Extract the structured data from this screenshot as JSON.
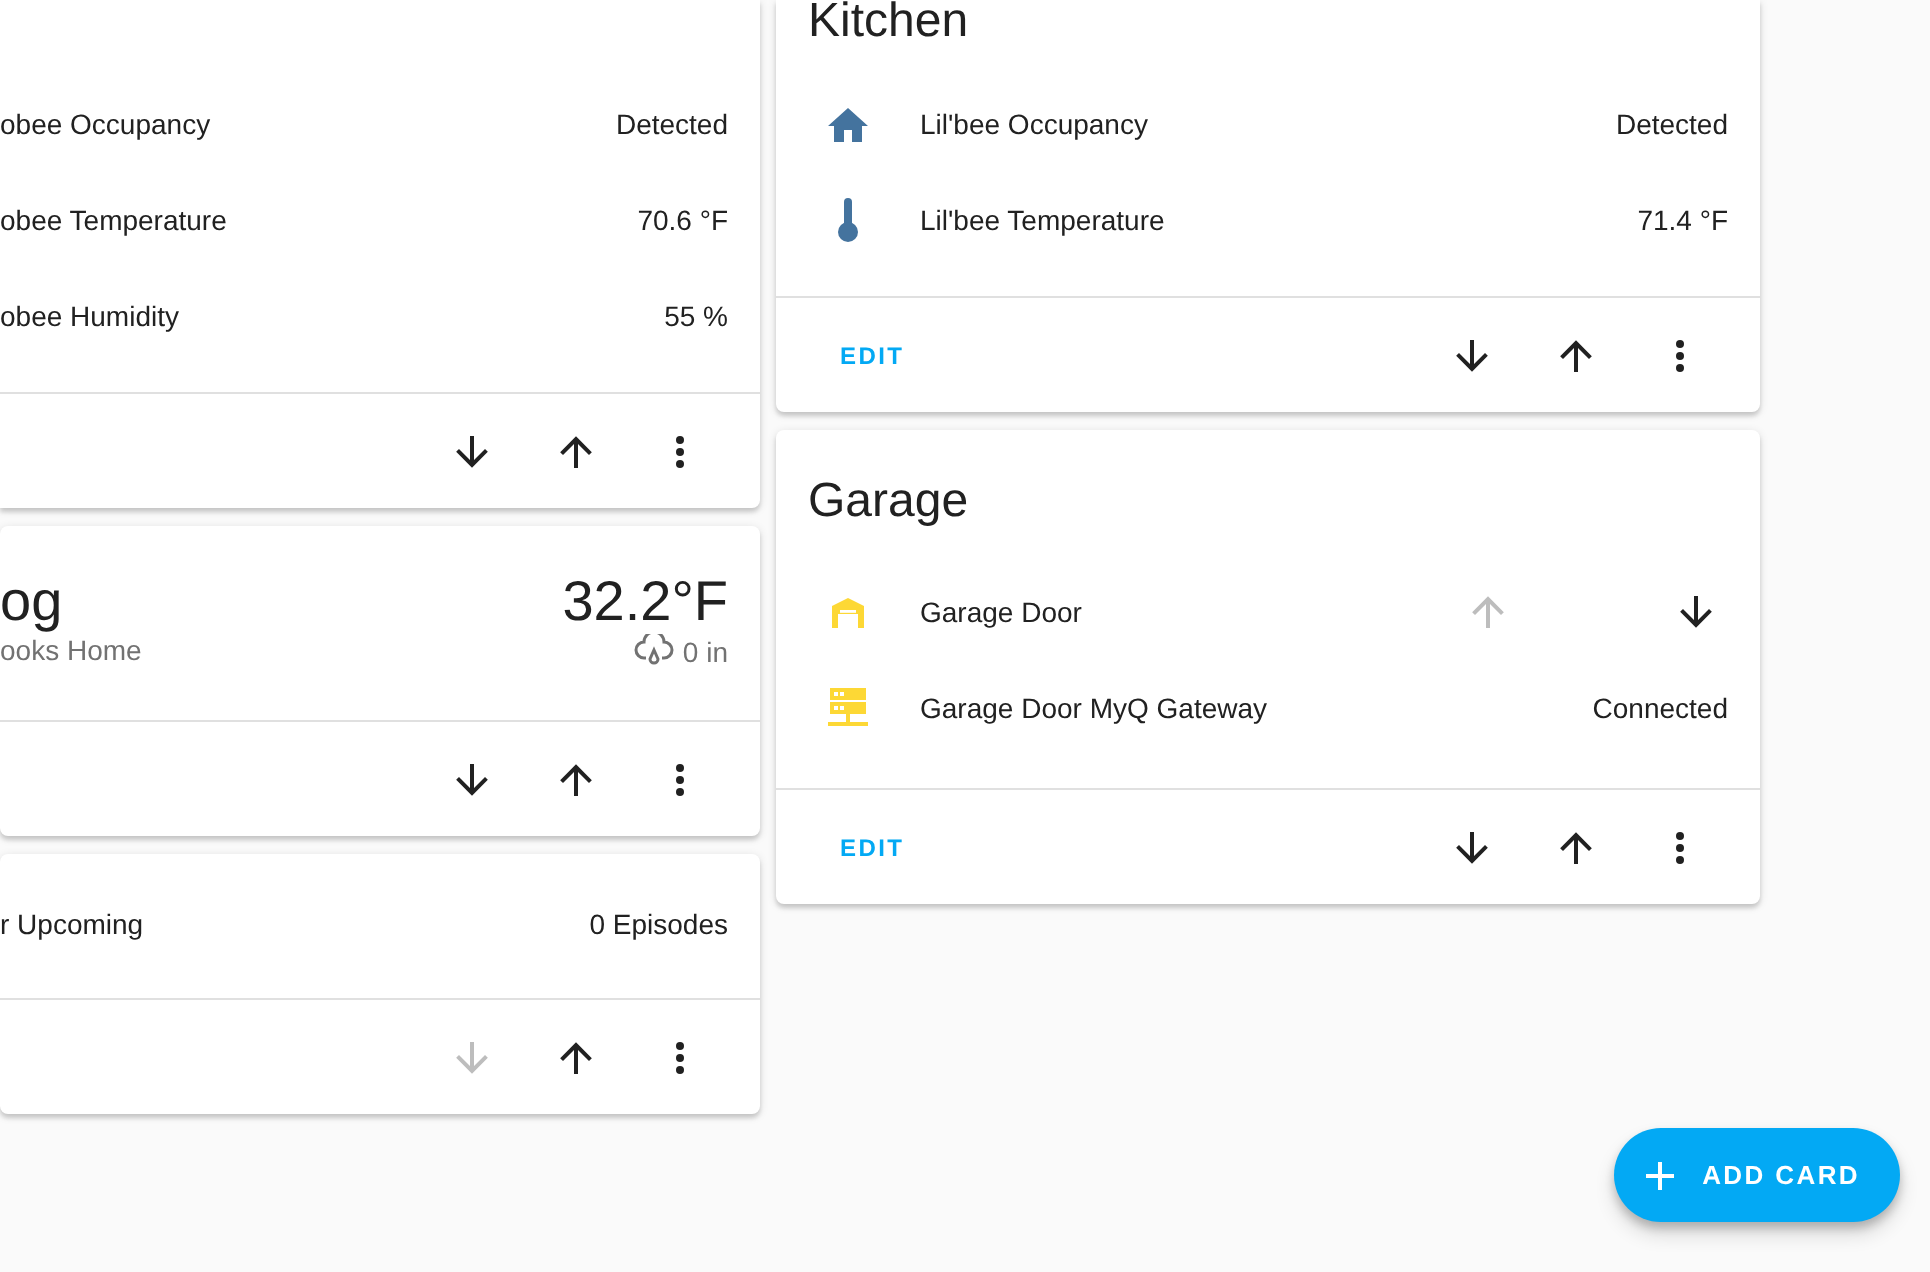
{
  "left_cards": [
    {
      "kind": "entities",
      "rows": [
        {
          "name": "obee Occupancy",
          "value": "Detected"
        },
        {
          "name": "obee Temperature",
          "value": "70.6 °F"
        },
        {
          "name": "obee Humidity",
          "value": "55 %"
        }
      ],
      "footer": {
        "move_down_disabled": false,
        "move_up_disabled": false
      }
    },
    {
      "kind": "weather",
      "name": "og",
      "location": "ooks Home",
      "temperature": "32.2°F",
      "precipitation": "0 in",
      "footer": {
        "move_down_disabled": false,
        "move_up_disabled": false
      }
    },
    {
      "kind": "entities",
      "rows": [
        {
          "name": "r Upcoming",
          "value": "0 Episodes"
        }
      ],
      "footer": {
        "move_down_disabled": true,
        "move_up_disabled": false
      }
    }
  ],
  "right_cards": [
    {
      "title": "Kitchen",
      "rows": [
        {
          "kind": "occupancy",
          "color": "#44739e",
          "name": "Lil'bee Occupancy",
          "value": "Detected"
        },
        {
          "kind": "temperature",
          "color": "#44739e",
          "name": "Lil'bee Temperature",
          "value": "71.4 °F"
        }
      ],
      "footer": {
        "edit_label": "EDIT",
        "move_down_disabled": false,
        "move_up_disabled": false
      }
    },
    {
      "title": "Garage",
      "rows": [
        {
          "kind": "cover",
          "color": "#fdd835",
          "name": "Garage Door",
          "open_disabled": true,
          "close_disabled": false
        },
        {
          "kind": "connectivity",
          "color": "#fdd835",
          "name": "Garage Door MyQ Gateway",
          "value": "Connected"
        }
      ],
      "footer": {
        "edit_label": "EDIT",
        "move_down_disabled": false,
        "move_up_disabled": false
      }
    }
  ],
  "fab": {
    "label": "ADD CARD"
  }
}
